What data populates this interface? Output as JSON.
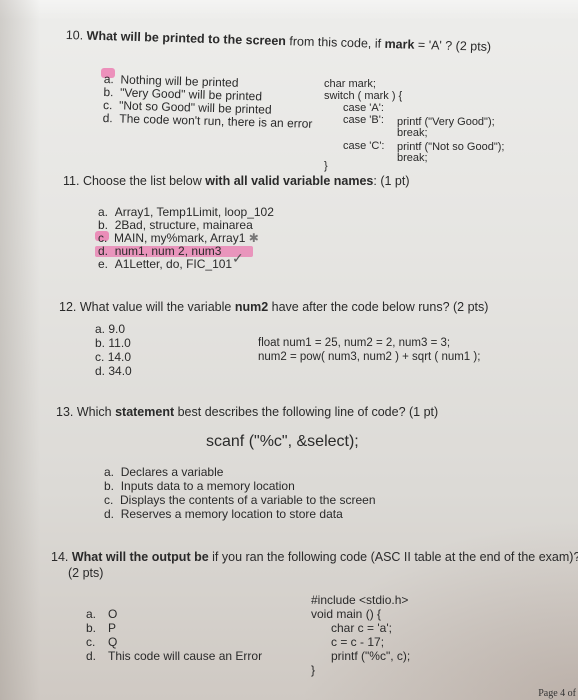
{
  "questions": [
    {
      "number": "10.",
      "prompt_bold": "What will be printed to the screen",
      "prompt_rest": " from this code, if ",
      "prompt_bold2": "mark",
      "prompt_tail": " = 'A' ? (2 pts)",
      "options": [
        {
          "letter": "a.",
          "text": "Nothing will be printed",
          "highlighted": true
        },
        {
          "letter": "b.",
          "text": "\"Very Good\" will be printed",
          "highlighted": false
        },
        {
          "letter": "c.",
          "text": "\"Not so Good\" will be printed",
          "highlighted": false
        },
        {
          "letter": "d.",
          "text": "The code won't run, there is an error",
          "highlighted": false
        }
      ],
      "code": [
        "char mark;",
        "switch ( mark ) {",
        "case 'A':",
        "case 'B':",
        "printf (\"Very Good\");",
        "break;",
        "case 'C':",
        "printf (\"Not so Good\");",
        "break;",
        "}"
      ]
    },
    {
      "number": "11.",
      "prompt_rest": "Choose the list below ",
      "prompt_bold": "with all valid variable names",
      "prompt_tail": ": (1 pt)",
      "options": [
        {
          "letter": "a.",
          "text": "Array1, Temp1Limit, loop_102",
          "highlighted": false
        },
        {
          "letter": "b.",
          "text": "2Bad, structure, mainarea",
          "highlighted": false
        },
        {
          "letter": "c.",
          "text": "MAIN, my%mark, Array1",
          "highlighted": true,
          "annotation": "✱"
        },
        {
          "letter": "d.",
          "text": "num1, num 2, num3",
          "highlighted": true,
          "annotation": "✓"
        },
        {
          "letter": "e.",
          "text": "A1Letter, do, FIC_101",
          "highlighted": false
        }
      ]
    },
    {
      "number": "12.",
      "prompt_rest": "What value will the variable ",
      "prompt_bold": "num2",
      "prompt_tail": " have after the code below runs? (2 pts)",
      "options": [
        {
          "letter": "a.",
          "text": "9.0"
        },
        {
          "letter": "b.",
          "text": "11.0"
        },
        {
          "letter": "c.",
          "text": "14.0"
        },
        {
          "letter": "d.",
          "text": "34.0"
        }
      ],
      "code": [
        "float num1 = 25, num2 = 2, num3 = 3;",
        "num2 = pow( num3, num2 )  + sqrt ( num1 );"
      ]
    },
    {
      "number": "13.",
      "prompt_rest": "Which ",
      "prompt_bold": "statement",
      "prompt_tail": " best describes the following line of code? (1 pt)",
      "code_line": "scanf (\"%c\", &select);",
      "options": [
        {
          "letter": "a.",
          "text": "Declares a variable"
        },
        {
          "letter": "b.",
          "text": "Inputs data to a memory location"
        },
        {
          "letter": "c.",
          "text": "Displays the contents of a variable to the screen"
        },
        {
          "letter": "d.",
          "text": "Reserves a memory location to store data"
        }
      ]
    },
    {
      "number": "14.",
      "prompt_bold": "What will the output be",
      "prompt_rest": " if you ran the following code (ASC II table at the end of the exam)?",
      "prompt_tail": "(2 pts)",
      "options": [
        {
          "letter": "a.",
          "text": "O"
        },
        {
          "letter": "b.",
          "text": "P"
        },
        {
          "letter": "c.",
          "text": "Q"
        },
        {
          "letter": "d.",
          "text": "This code will cause an Error"
        }
      ],
      "code": [
        "#include <stdio.h>",
        "void main () {",
        "char c = 'a';",
        "c = c - 17;",
        "printf (\"%c\", c);",
        "}"
      ]
    }
  ],
  "footer": "Page 4 of"
}
